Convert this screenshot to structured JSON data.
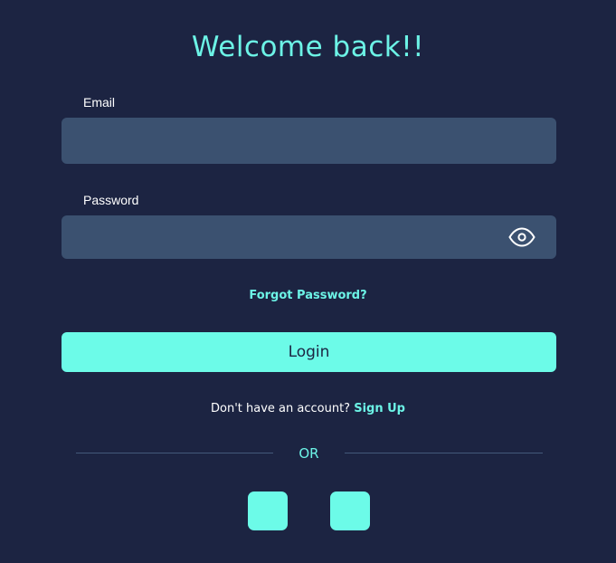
{
  "header": {
    "title": "Welcome back!!"
  },
  "form": {
    "email_label": "Email",
    "email_value": "",
    "password_label": "Password",
    "password_value": "",
    "password_toggle_icon": "eye-icon",
    "forgot_password": "Forgot Password?",
    "login_label": "Login"
  },
  "signup": {
    "prompt": "Don't have an account? ",
    "link": "Sign Up"
  },
  "divider": {
    "text": "OR"
  },
  "social_buttons": [
    {
      "icon": "social-login-icon"
    },
    {
      "icon": "social-login-icon"
    }
  ],
  "colors": {
    "background": "#1c2442",
    "accent": "#6cf3e6",
    "button": "#6cfbe8",
    "field": "#3b5170"
  }
}
